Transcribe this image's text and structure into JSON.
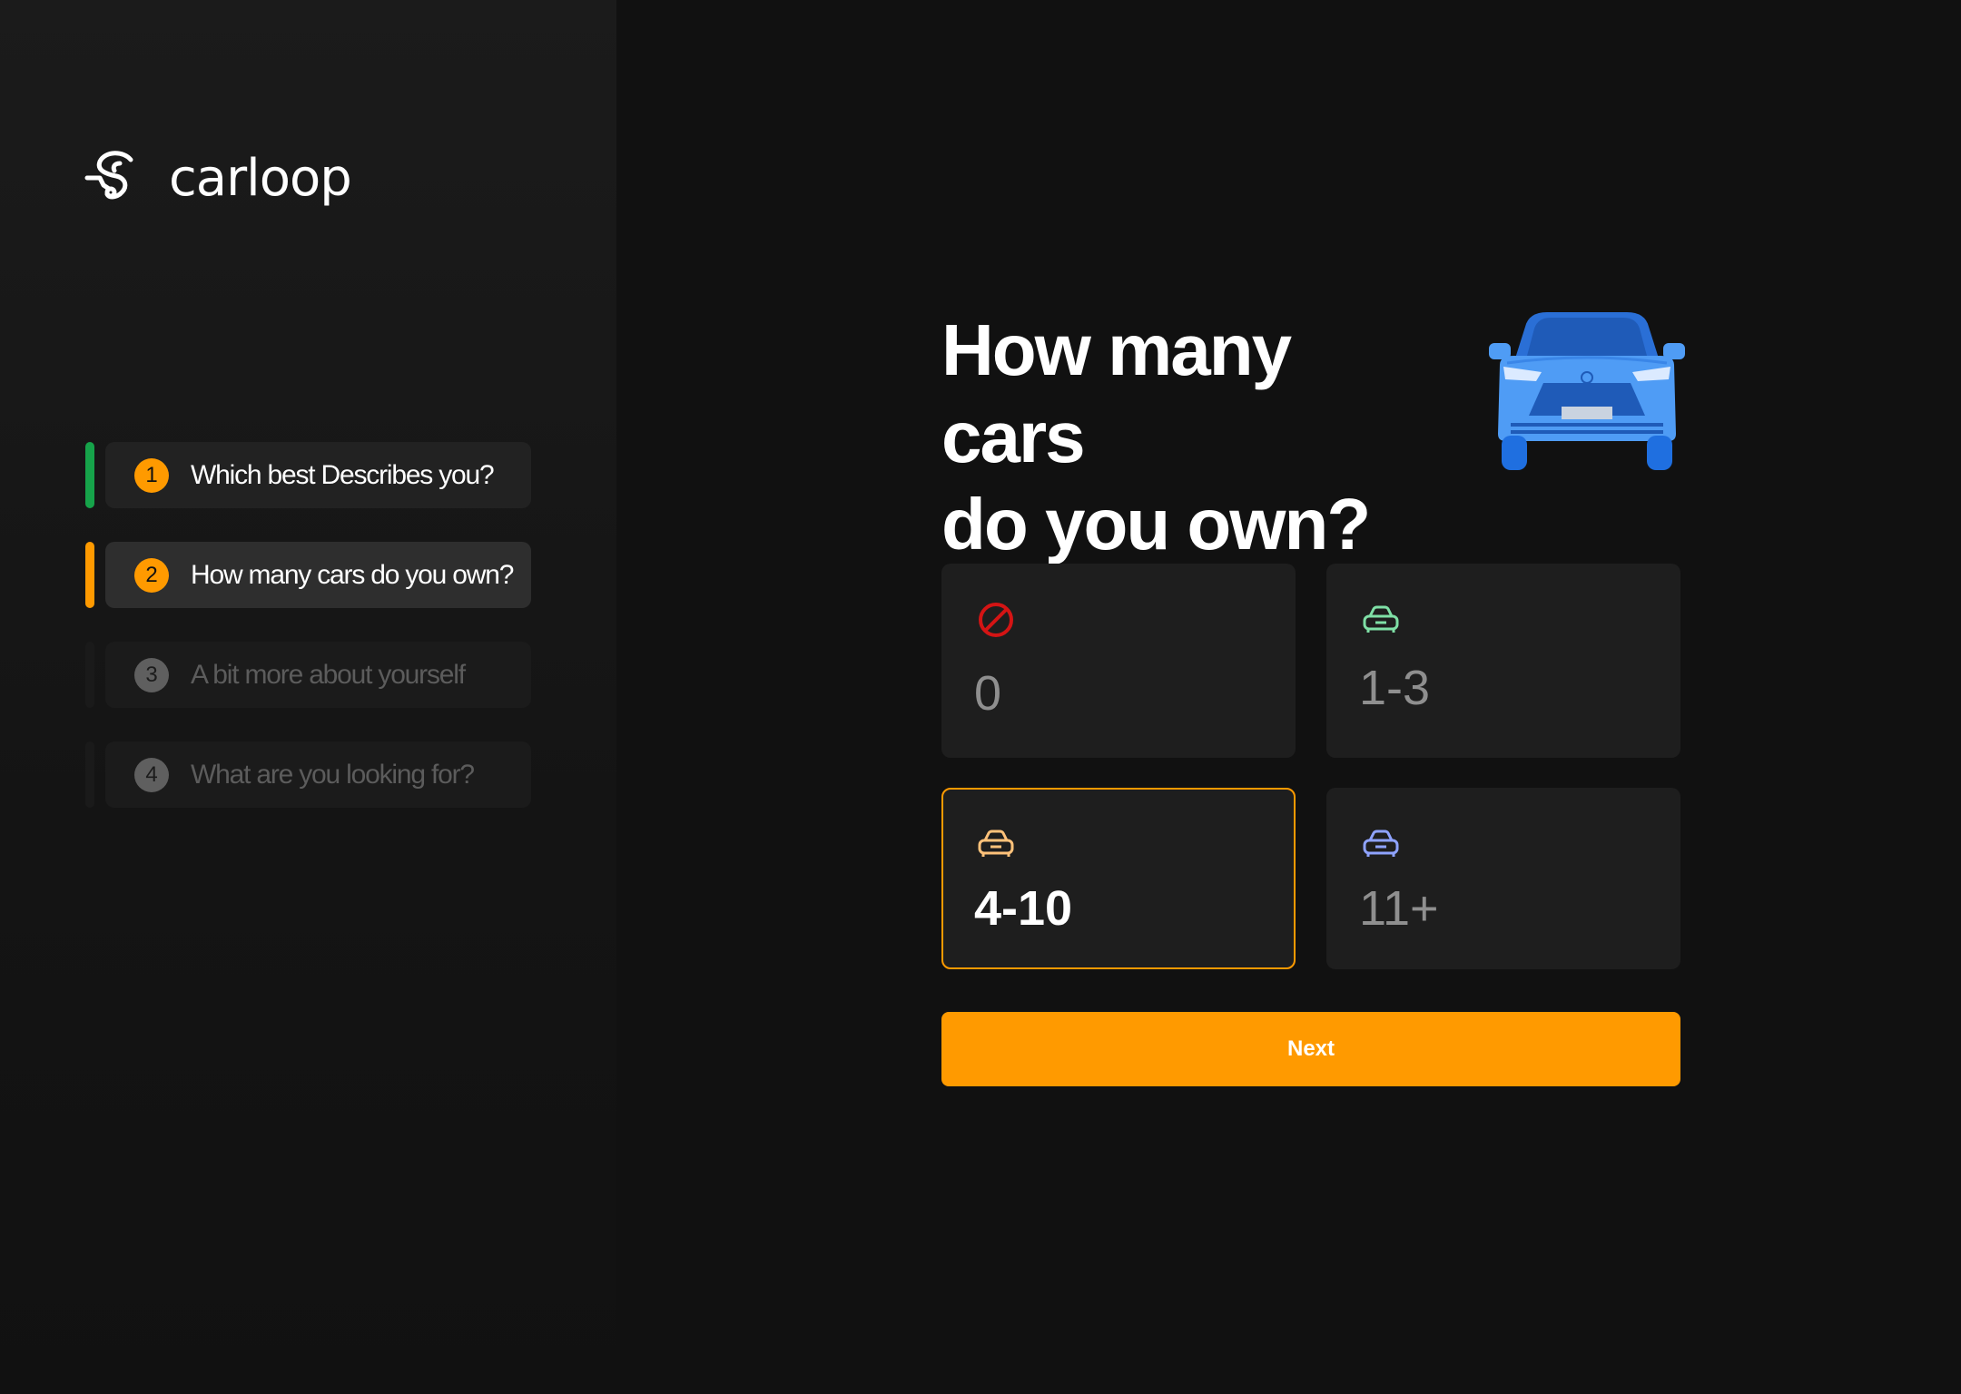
{
  "brand": {
    "name": "carloop",
    "logo_icon": "carloop-logo-icon"
  },
  "steps": [
    {
      "number": "1",
      "label": "Which best Describes you?",
      "state": "done"
    },
    {
      "number": "2",
      "label": "How many cars do you own?",
      "state": "active"
    },
    {
      "number": "3",
      "label": "A bit more about yourself",
      "state": "pending"
    },
    {
      "number": "4",
      "label": "What are you looking for?",
      "state": "pending"
    }
  ],
  "question": {
    "line1": "How many cars",
    "line2": "do you own?",
    "illustration": "car-front-illustration"
  },
  "options": [
    {
      "value": "0",
      "icon": "no-entry-icon",
      "icon_color": "#d41414",
      "selected": false
    },
    {
      "value": "1-3",
      "icon": "car-icon",
      "icon_color": "#7fe0a6",
      "selected": false
    },
    {
      "value": "4-10",
      "icon": "car-icon",
      "icon_color": "#ffc27a",
      "selected": true
    },
    {
      "value": "11+",
      "icon": "car-icon",
      "icon_color": "#8fa3ff",
      "selected": false
    }
  ],
  "next_button": {
    "label": "Next"
  },
  "colors": {
    "accent": "#ff9a00",
    "done": "#16a34a",
    "background": "#111111",
    "card": "#1e1e1e",
    "car_illustration": "#3b8cf0"
  }
}
